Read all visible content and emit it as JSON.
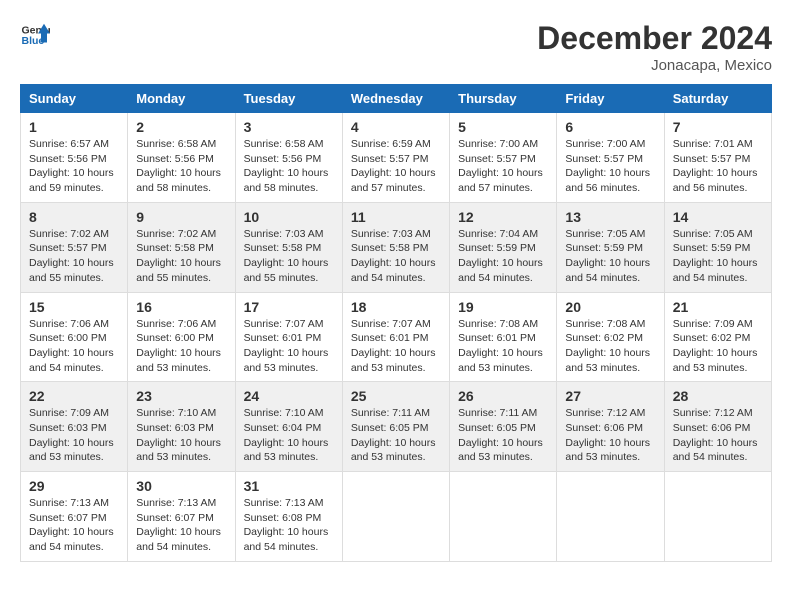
{
  "header": {
    "logo_line1": "General",
    "logo_line2": "Blue",
    "month_year": "December 2024",
    "location": "Jonacapa, Mexico"
  },
  "weekdays": [
    "Sunday",
    "Monday",
    "Tuesday",
    "Wednesday",
    "Thursday",
    "Friday",
    "Saturday"
  ],
  "weeks": [
    [
      {
        "day": "1",
        "sunrise": "6:57 AM",
        "sunset": "5:56 PM",
        "daylight": "10 hours and 59 minutes."
      },
      {
        "day": "2",
        "sunrise": "6:58 AM",
        "sunset": "5:56 PM",
        "daylight": "10 hours and 58 minutes."
      },
      {
        "day": "3",
        "sunrise": "6:58 AM",
        "sunset": "5:56 PM",
        "daylight": "10 hours and 58 minutes."
      },
      {
        "day": "4",
        "sunrise": "6:59 AM",
        "sunset": "5:57 PM",
        "daylight": "10 hours and 57 minutes."
      },
      {
        "day": "5",
        "sunrise": "7:00 AM",
        "sunset": "5:57 PM",
        "daylight": "10 hours and 57 minutes."
      },
      {
        "day": "6",
        "sunrise": "7:00 AM",
        "sunset": "5:57 PM",
        "daylight": "10 hours and 56 minutes."
      },
      {
        "day": "7",
        "sunrise": "7:01 AM",
        "sunset": "5:57 PM",
        "daylight": "10 hours and 56 minutes."
      }
    ],
    [
      {
        "day": "8",
        "sunrise": "7:02 AM",
        "sunset": "5:57 PM",
        "daylight": "10 hours and 55 minutes."
      },
      {
        "day": "9",
        "sunrise": "7:02 AM",
        "sunset": "5:58 PM",
        "daylight": "10 hours and 55 minutes."
      },
      {
        "day": "10",
        "sunrise": "7:03 AM",
        "sunset": "5:58 PM",
        "daylight": "10 hours and 55 minutes."
      },
      {
        "day": "11",
        "sunrise": "7:03 AM",
        "sunset": "5:58 PM",
        "daylight": "10 hours and 54 minutes."
      },
      {
        "day": "12",
        "sunrise": "7:04 AM",
        "sunset": "5:59 PM",
        "daylight": "10 hours and 54 minutes."
      },
      {
        "day": "13",
        "sunrise": "7:05 AM",
        "sunset": "5:59 PM",
        "daylight": "10 hours and 54 minutes."
      },
      {
        "day": "14",
        "sunrise": "7:05 AM",
        "sunset": "5:59 PM",
        "daylight": "10 hours and 54 minutes."
      }
    ],
    [
      {
        "day": "15",
        "sunrise": "7:06 AM",
        "sunset": "6:00 PM",
        "daylight": "10 hours and 54 minutes."
      },
      {
        "day": "16",
        "sunrise": "7:06 AM",
        "sunset": "6:00 PM",
        "daylight": "10 hours and 53 minutes."
      },
      {
        "day": "17",
        "sunrise": "7:07 AM",
        "sunset": "6:01 PM",
        "daylight": "10 hours and 53 minutes."
      },
      {
        "day": "18",
        "sunrise": "7:07 AM",
        "sunset": "6:01 PM",
        "daylight": "10 hours and 53 minutes."
      },
      {
        "day": "19",
        "sunrise": "7:08 AM",
        "sunset": "6:01 PM",
        "daylight": "10 hours and 53 minutes."
      },
      {
        "day": "20",
        "sunrise": "7:08 AM",
        "sunset": "6:02 PM",
        "daylight": "10 hours and 53 minutes."
      },
      {
        "day": "21",
        "sunrise": "7:09 AM",
        "sunset": "6:02 PM",
        "daylight": "10 hours and 53 minutes."
      }
    ],
    [
      {
        "day": "22",
        "sunrise": "7:09 AM",
        "sunset": "6:03 PM",
        "daylight": "10 hours and 53 minutes."
      },
      {
        "day": "23",
        "sunrise": "7:10 AM",
        "sunset": "6:03 PM",
        "daylight": "10 hours and 53 minutes."
      },
      {
        "day": "24",
        "sunrise": "7:10 AM",
        "sunset": "6:04 PM",
        "daylight": "10 hours and 53 minutes."
      },
      {
        "day": "25",
        "sunrise": "7:11 AM",
        "sunset": "6:05 PM",
        "daylight": "10 hours and 53 minutes."
      },
      {
        "day": "26",
        "sunrise": "7:11 AM",
        "sunset": "6:05 PM",
        "daylight": "10 hours and 53 minutes."
      },
      {
        "day": "27",
        "sunrise": "7:12 AM",
        "sunset": "6:06 PM",
        "daylight": "10 hours and 53 minutes."
      },
      {
        "day": "28",
        "sunrise": "7:12 AM",
        "sunset": "6:06 PM",
        "daylight": "10 hours and 54 minutes."
      }
    ],
    [
      {
        "day": "29",
        "sunrise": "7:13 AM",
        "sunset": "6:07 PM",
        "daylight": "10 hours and 54 minutes."
      },
      {
        "day": "30",
        "sunrise": "7:13 AM",
        "sunset": "6:07 PM",
        "daylight": "10 hours and 54 minutes."
      },
      {
        "day": "31",
        "sunrise": "7:13 AM",
        "sunset": "6:08 PM",
        "daylight": "10 hours and 54 minutes."
      },
      null,
      null,
      null,
      null
    ]
  ],
  "labels": {
    "sunrise_prefix": "Sunrise: ",
    "sunset_prefix": "Sunset: ",
    "daylight_prefix": "Daylight: "
  }
}
